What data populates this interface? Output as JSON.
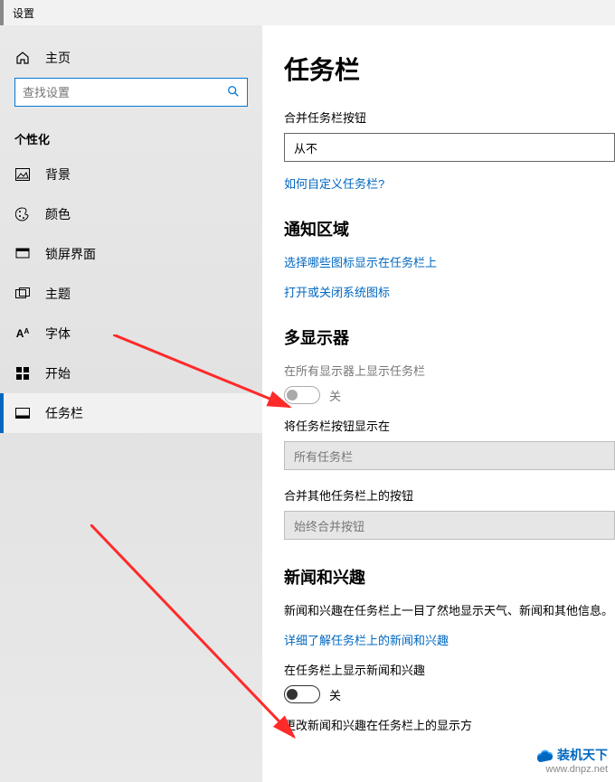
{
  "window": {
    "title": "设置"
  },
  "sidebar": {
    "home": "主页",
    "search_placeholder": "查找设置",
    "section": "个性化",
    "items": [
      {
        "icon": "image-icon",
        "label": "背景"
      },
      {
        "icon": "palette-icon",
        "label": "颜色"
      },
      {
        "icon": "lockscreen-icon",
        "label": "锁屏界面"
      },
      {
        "icon": "theme-icon",
        "label": "主题"
      },
      {
        "icon": "font-icon",
        "label": "字体"
      },
      {
        "icon": "start-icon",
        "label": "开始"
      },
      {
        "icon": "taskbar-icon",
        "label": "任务栏"
      }
    ]
  },
  "content": {
    "title": "任务栏",
    "combine": {
      "label": "合并任务栏按钮",
      "value": "从不"
    },
    "customize_link": "如何自定义任务栏?",
    "notify": {
      "heading": "通知区域",
      "link1": "选择哪些图标显示在任务栏上",
      "link2": "打开或关闭系统图标"
    },
    "multi": {
      "heading": "多显示器",
      "show_all_label": "在所有显示器上显示任务栏",
      "show_all_state": "关",
      "show_buttons_label": "将任务栏按钮显示在",
      "show_buttons_value": "所有任务栏",
      "combine_other_label": "合并其他任务栏上的按钮",
      "combine_other_value": "始终合并按钮"
    },
    "news": {
      "heading": "新闻和兴趣",
      "desc": "新闻和兴趣在任务栏上一目了然地显示天气、新闻和其他信息。",
      "learn_link": "详细了解任务栏上的新闻和兴趣",
      "show_label": "在任务栏上显示新闻和兴趣",
      "show_state": "关",
      "change_label": "更改新闻和兴趣在任务栏上的显示方"
    }
  },
  "brand": {
    "name": "装机天下",
    "url": "www.dnpz.net"
  }
}
